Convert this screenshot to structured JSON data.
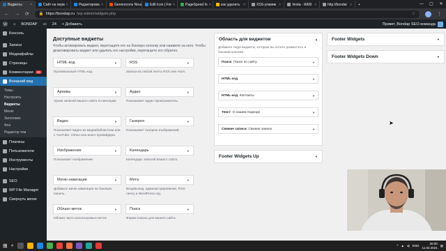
{
  "browser": {
    "tabs": [
      {
        "label": "Виджеты",
        "active": true,
        "color": "#2271b1"
      },
      {
        "label": "Сайт на перв",
        "color": "#1e88e5"
      },
      {
        "label": "Редактирова",
        "color": "#1e88e5"
      },
      {
        "label": "Generecons Neue",
        "color": "#e65100"
      },
      {
        "label": "Edit Icon | For",
        "color": "#1e88e5"
      },
      {
        "label": "PageSpeed In",
        "color": "#34a853"
      },
      {
        "label": "как удалить",
        "color": "#fbbc05"
      },
      {
        "label": "XSS-уязвим",
        "color": "#9aa0a6"
      },
      {
        "label": "Vesta - WEB",
        "color": "#9aa0a6"
      },
      {
        "label": "http://bondar",
        "color": "#9aa0a6"
      }
    ],
    "url_host": "https://bondap.ru",
    "url_path": "/wp-admin/widgets.php",
    "window_controls": [
      "—",
      "▢",
      "✕"
    ]
  },
  "adminbar": {
    "site_name": "BONDAP",
    "comments_count": "24",
    "new_label": "+ Добавить",
    "greeting": "Привет, Bondap SEO-команда"
  },
  "sidebar": {
    "items_top": [
      {
        "label": "Консоль"
      }
    ],
    "items_mid": [
      {
        "label": "Записи"
      },
      {
        "label": "Медиафайлы"
      },
      {
        "label": "Страницы"
      },
      {
        "label": "Комментарии",
        "badge": "24"
      }
    ],
    "appearance": {
      "label": "Внешний вид"
    },
    "submenu": [
      {
        "label": "Темы"
      },
      {
        "label": "Настроить"
      },
      {
        "label": "Виджеты",
        "current": true
      },
      {
        "label": "Меню"
      },
      {
        "label": "Заголовок"
      },
      {
        "label": "Фон"
      },
      {
        "label": "Редактор тем"
      }
    ],
    "items_bottom": [
      {
        "label": "Плагины"
      },
      {
        "label": "Пользователи"
      },
      {
        "label": "Инструменты"
      },
      {
        "label": "Настройки"
      }
    ],
    "items_extra": [
      {
        "label": "SEO"
      },
      {
        "label": "WP File Manager"
      },
      {
        "label": "Свернуть меню"
      }
    ]
  },
  "available": {
    "title": "Доступные виджеты",
    "description": "Чтобы активировать виджет, перетащите его на боковую колонку или нажмите на него. Чтобы деактивировать виджет или удалить его настройки, перетащите его обратно.",
    "widgets": [
      {
        "name": "HTML-код",
        "desc": "Произвольный HTML-код."
      },
      {
        "name": "RSS",
        "desc": "Записи из любой ленты RSS или Atom."
      },
      {
        "name": "Архивы",
        "desc": "Архив записей вашего сайта по месяцам."
      },
      {
        "name": "Аудио",
        "desc": "Показывает аудио проигрыватель."
      },
      {
        "name": "Видео",
        "desc": "Показывает видео из медиабиблиотеки или с YouTube, Vimeo или иного провайдера."
      },
      {
        "name": "Галерея",
        "desc": "Показывает галерею изображений."
      },
      {
        "name": "Изображение",
        "desc": "Показывает изображение."
      },
      {
        "name": "Календарь",
        "desc": "Календарь записей вашего сайта."
      },
      {
        "name": "Меню навигации",
        "desc": "Добавьте меню навигации на боковую панель."
      },
      {
        "name": "Мета",
        "desc": "Вход/выход, администрирование, RSS-ленту и WordPress.org."
      },
      {
        "name": "Облако меток",
        "desc": "Облако часто используемых меток."
      },
      {
        "name": "Поиск",
        "desc": "Форма поиска для вашего сайта."
      }
    ]
  },
  "widget_area": {
    "title": "Область для виджетов",
    "description": "Добавьте сюда виджеты, которые вы хотите разместить в боковой колонке.",
    "widgets": [
      {
        "name": "Поиск",
        "title": ": Поиск по сайту"
      },
      {
        "name": "HTML-код",
        "title": ""
      },
      {
        "name": "HTML-код",
        "title": ": Контакты"
      },
      {
        "name": "Текст",
        "title": ": О нашем подходе"
      },
      {
        "name": "Свежие записи",
        "title": ": Свежие записи"
      }
    ]
  },
  "footer_up": {
    "title": "Footer Widgets Up"
  },
  "footer_widgets": {
    "title": "Footer Widgets"
  },
  "footer_down": {
    "title": "Footer Widgets Down"
  },
  "taskbar": {
    "lang": "ENG",
    "time": "20:00",
    "date": "11.02.2021"
  },
  "colors": {
    "admin_dark": "#1d2327",
    "admin_blue": "#2271b1",
    "background": "#f0f0f1"
  }
}
